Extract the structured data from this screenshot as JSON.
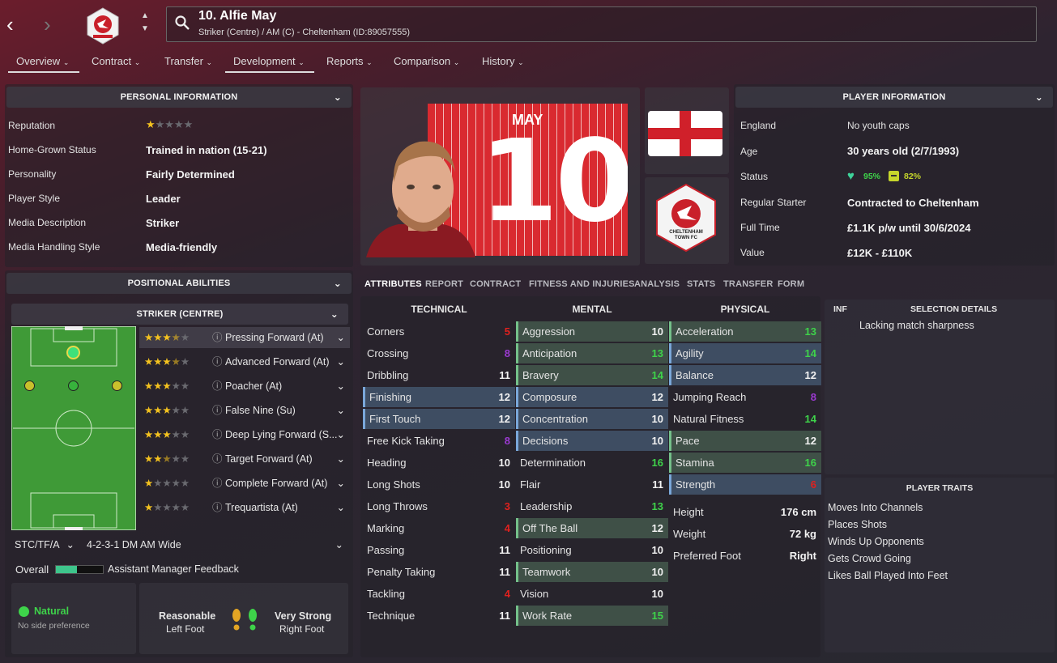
{
  "header": {
    "title": "10. Alfie May",
    "subtitle": "Striker (Centre) / AM (C) - Cheltenham (ID:89057555)"
  },
  "tabs": [
    {
      "label": "Overview"
    },
    {
      "label": "Contract"
    },
    {
      "label": "Transfer"
    },
    {
      "label": "Development"
    },
    {
      "label": "Reports"
    },
    {
      "label": "Comparison"
    },
    {
      "label": "History"
    }
  ],
  "personal": {
    "title": "PERSONAL INFORMATION",
    "rows": [
      {
        "label": "Reputation",
        "value": ""
      },
      {
        "label": "Home-Grown Status",
        "value": "Trained in nation (15-21)"
      },
      {
        "label": "Personality",
        "value": "Fairly Determined"
      },
      {
        "label": "Player Style",
        "value": "Leader"
      },
      {
        "label": "Media Description",
        "value": "Striker"
      },
      {
        "label": "Media Handling Style",
        "value": "Media-friendly"
      }
    ],
    "reputation_stars": 1
  },
  "positional": {
    "title": "POSITIONAL ABILITIES",
    "position": "STRIKER (CENTRE)",
    "roles": [
      {
        "name": "Pressing Forward (At)",
        "stars": 3.5
      },
      {
        "name": "Advanced Forward (At)",
        "stars": 3.5
      },
      {
        "name": "Poacher (At)",
        "stars": 3
      },
      {
        "name": "False Nine (Su)",
        "stars": 3
      },
      {
        "name": "Deep Lying Forward (S...",
        "stars": 3
      },
      {
        "name": "Target Forward (At)",
        "stars": 2.5
      },
      {
        "name": "Complete Forward (At)",
        "stars": 1
      },
      {
        "name": "Trequartista (At)",
        "stars": 1
      }
    ],
    "pos_select": "STC/TF/A",
    "tactic_select": "4-2-3-1 DM AM Wide",
    "overall_label": "Overall",
    "feedback_label": "Assistant Manager Feedback",
    "foot_natural": "Natural",
    "foot_natural_sub": "No side preference",
    "left_foot_level": "Reasonable",
    "left_foot_label": "Left Foot",
    "right_foot_level": "Very Strong",
    "right_foot_label": "Right Foot"
  },
  "kit": {
    "name": "MAY",
    "number": "10",
    "badge_text": "CHELTENHAM TOWN FC"
  },
  "player_info": {
    "title": "PLAYER INFORMATION",
    "rows": [
      {
        "label": "England",
        "value": "No youth caps"
      },
      {
        "label": "Age",
        "value": "30 years old (2/7/1993)"
      },
      {
        "label": "Status",
        "value": ""
      },
      {
        "label": "Regular Starter",
        "value": "Contracted to Cheltenham"
      },
      {
        "label": "Full Time",
        "value": "£1.1K p/w until 30/6/2024"
      },
      {
        "label": "Value",
        "value": "£12K - £110K"
      }
    ],
    "status_fitness": "95%",
    "status_sharpness": "82%"
  },
  "subtabs": [
    {
      "label": "ATTRIBUTES"
    },
    {
      "label": "REPORT"
    },
    {
      "label": "CONTRACT"
    },
    {
      "label": "FITNESS AND INJURIES"
    },
    {
      "label": "ANALYSIS"
    },
    {
      "label": "STATS"
    },
    {
      "label": "TRANSFER"
    },
    {
      "label": "FORM"
    }
  ],
  "attributes": {
    "technical_title": "TECHNICAL",
    "mental_title": "MENTAL",
    "physical_title": "PHYSICAL",
    "technical": [
      {
        "name": "Corners",
        "value": "5",
        "color": "red"
      },
      {
        "name": "Crossing",
        "value": "8",
        "color": "purple"
      },
      {
        "name": "Dribbling",
        "value": "11",
        "color": "white"
      },
      {
        "name": "Finishing",
        "value": "12",
        "color": "white",
        "hl": "blue"
      },
      {
        "name": "First Touch",
        "value": "12",
        "color": "white",
        "hl": "blue"
      },
      {
        "name": "Free Kick Taking",
        "value": "8",
        "color": "purple"
      },
      {
        "name": "Heading",
        "value": "10",
        "color": "white"
      },
      {
        "name": "Long Shots",
        "value": "10",
        "color": "white"
      },
      {
        "name": "Long Throws",
        "value": "3",
        "color": "red"
      },
      {
        "name": "Marking",
        "value": "4",
        "color": "red"
      },
      {
        "name": "Passing",
        "value": "11",
        "color": "white"
      },
      {
        "name": "Penalty Taking",
        "value": "11",
        "color": "white"
      },
      {
        "name": "Tackling",
        "value": "4",
        "color": "red"
      },
      {
        "name": "Technique",
        "value": "11",
        "color": "white"
      }
    ],
    "mental": [
      {
        "name": "Aggression",
        "value": "10",
        "color": "white",
        "hl": "green"
      },
      {
        "name": "Anticipation",
        "value": "13",
        "color": "green",
        "hl": "green"
      },
      {
        "name": "Bravery",
        "value": "14",
        "color": "green",
        "hl": "green"
      },
      {
        "name": "Composure",
        "value": "12",
        "color": "white",
        "hl": "blue"
      },
      {
        "name": "Concentration",
        "value": "10",
        "color": "white",
        "hl": "blue"
      },
      {
        "name": "Decisions",
        "value": "10",
        "color": "white",
        "hl": "blue"
      },
      {
        "name": "Determination",
        "value": "16",
        "color": "green"
      },
      {
        "name": "Flair",
        "value": "11",
        "color": "white"
      },
      {
        "name": "Leadership",
        "value": "13",
        "color": "green"
      },
      {
        "name": "Off The Ball",
        "value": "12",
        "color": "white",
        "hl": "green"
      },
      {
        "name": "Positioning",
        "value": "10",
        "color": "white"
      },
      {
        "name": "Teamwork",
        "value": "10",
        "color": "white",
        "hl": "green"
      },
      {
        "name": "Vision",
        "value": "10",
        "color": "white"
      },
      {
        "name": "Work Rate",
        "value": "15",
        "color": "green",
        "hl": "green"
      }
    ],
    "physical": [
      {
        "name": "Acceleration",
        "value": "13",
        "color": "green",
        "hl": "green"
      },
      {
        "name": "Agility",
        "value": "14",
        "color": "green",
        "hl": "blue"
      },
      {
        "name": "Balance",
        "value": "12",
        "color": "white",
        "hl": "blue"
      },
      {
        "name": "Jumping Reach",
        "value": "8",
        "color": "purple"
      },
      {
        "name": "Natural Fitness",
        "value": "14",
        "color": "green"
      },
      {
        "name": "Pace",
        "value": "12",
        "color": "white",
        "hl": "green"
      },
      {
        "name": "Stamina",
        "value": "16",
        "color": "green",
        "hl": "green"
      },
      {
        "name": "Strength",
        "value": "6",
        "color": "red",
        "hl": "blue"
      }
    ],
    "body": [
      {
        "name": "Height",
        "value": "176 cm"
      },
      {
        "name": "Weight",
        "value": "72 kg"
      },
      {
        "name": "Preferred Foot",
        "value": "Right"
      }
    ]
  },
  "selection": {
    "inf_label": "INF",
    "title": "SELECTION DETAILS",
    "text": "Lacking match sharpness"
  },
  "traits": {
    "title": "PLAYER TRAITS",
    "items": [
      "Moves Into Channels",
      "Places Shots",
      "Winds Up Opponents",
      "Gets Crowd Going",
      "Likes Ball Played Into Feet"
    ]
  },
  "colors": {
    "accent_green": "#3ed34a",
    "accent_red": "#e0211e",
    "accent_purple": "#9b3ad1",
    "star": "#f4c21f"
  }
}
